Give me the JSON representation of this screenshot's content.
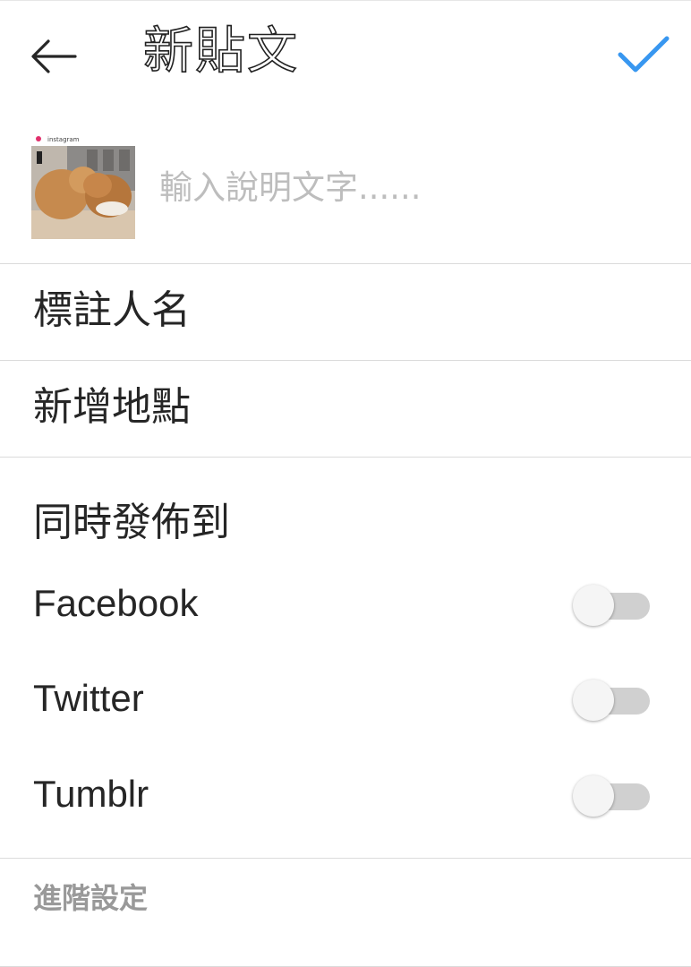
{
  "header": {
    "title": "新貼文",
    "back_icon": "arrow-left-icon",
    "confirm_icon": "check-icon",
    "accent_color": "#3897f0"
  },
  "caption": {
    "placeholder": "輸入說明文字......",
    "value": "",
    "thumbnail_text": "instagram"
  },
  "options": {
    "tag_people": "標註人名",
    "add_location": "新增地點"
  },
  "share": {
    "section_title": "同時發佈到",
    "items": [
      {
        "label": "Facebook",
        "enabled": false
      },
      {
        "label": "Twitter",
        "enabled": false
      },
      {
        "label": "Tumblr",
        "enabled": false
      }
    ]
  },
  "footer": {
    "advanced_settings": "進階設定"
  }
}
